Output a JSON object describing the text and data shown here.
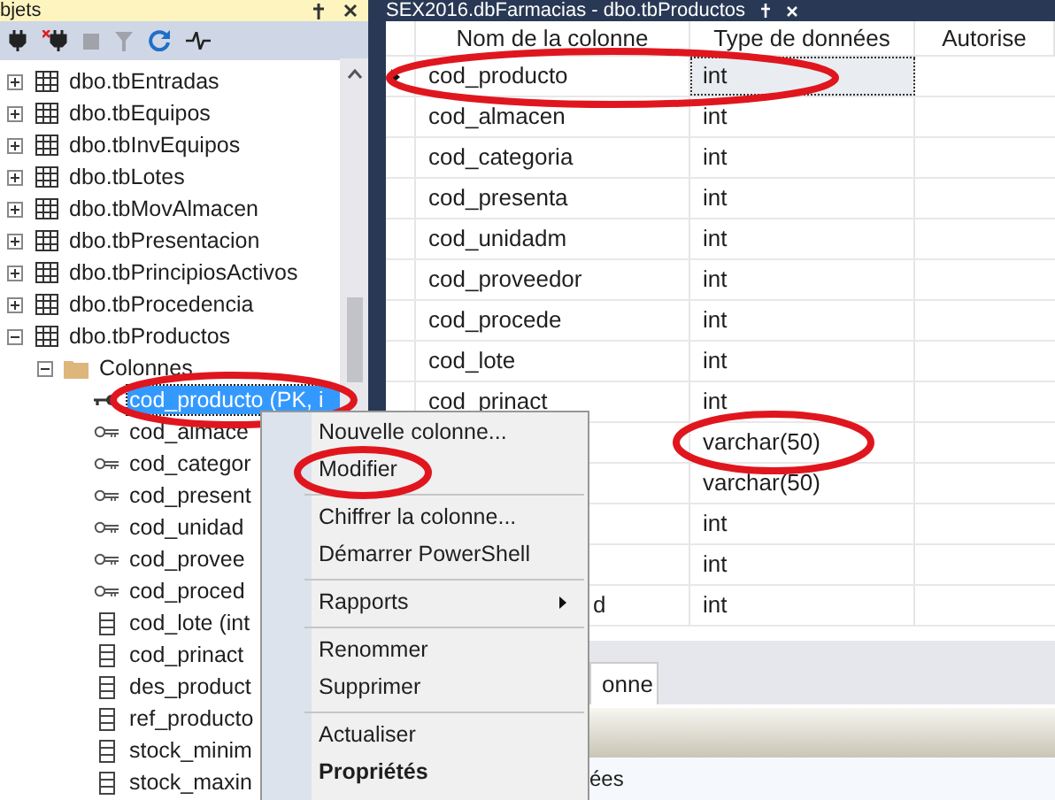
{
  "object_explorer": {
    "title": "bjets",
    "tree": [
      {
        "label": "dbo.tbEntradas",
        "kind": "table",
        "expanded": false
      },
      {
        "label": "dbo.tbEquipos",
        "kind": "table",
        "expanded": false
      },
      {
        "label": "dbo.tbInvEquipos",
        "kind": "table",
        "expanded": false
      },
      {
        "label": "dbo.tbLotes",
        "kind": "table",
        "expanded": false
      },
      {
        "label": "dbo.tbMovAlmacen",
        "kind": "table",
        "expanded": false
      },
      {
        "label": "dbo.tbPresentacion",
        "kind": "table",
        "expanded": false
      },
      {
        "label": "dbo.tbPrincipiosActivos",
        "kind": "table",
        "expanded": false
      },
      {
        "label": "dbo.tbProcedencia",
        "kind": "table",
        "expanded": false
      },
      {
        "label": "dbo.tbProductos",
        "kind": "table",
        "expanded": true,
        "children": [
          {
            "label": "Colonnes",
            "kind": "folder",
            "expanded": true,
            "children": [
              {
                "label": "cod_producto (PK, i",
                "kind": "primary-key",
                "selected": true
              },
              {
                "label": "cod_almace",
                "kind": "foreign-key",
                "selected": false
              },
              {
                "label": "cod_categor",
                "kind": "foreign-key",
                "selected": false
              },
              {
                "label": "cod_present",
                "kind": "foreign-key",
                "selected": false
              },
              {
                "label": "cod_unidad",
                "kind": "foreign-key",
                "selected": false
              },
              {
                "label": "cod_provee",
                "kind": "foreign-key",
                "selected": false
              },
              {
                "label": "cod_proced",
                "kind": "foreign-key",
                "selected": false
              },
              {
                "label": "cod_lote (int",
                "kind": "column",
                "selected": false
              },
              {
                "label": "cod_prinact",
                "kind": "column",
                "selected": false
              },
              {
                "label": "des_product",
                "kind": "column",
                "selected": false
              },
              {
                "label": "ref_producto",
                "kind": "column",
                "selected": false
              },
              {
                "label": "stock_minim",
                "kind": "column",
                "selected": false
              },
              {
                "label": "stock_maxin",
                "kind": "column",
                "selected": false
              }
            ]
          }
        ]
      }
    ]
  },
  "context_menu": [
    {
      "kind": "item",
      "label": "Nouvelle colonne..."
    },
    {
      "kind": "item",
      "label": "Modifier"
    },
    {
      "kind": "separator"
    },
    {
      "kind": "item",
      "label": "Chiffrer la colonne..."
    },
    {
      "kind": "item",
      "label": "Démarrer PowerShell"
    },
    {
      "kind": "separator"
    },
    {
      "kind": "submenu",
      "label": "Rapports"
    },
    {
      "kind": "separator"
    },
    {
      "kind": "item",
      "label": "Renommer"
    },
    {
      "kind": "item",
      "label": "Supprimer"
    },
    {
      "kind": "separator"
    },
    {
      "kind": "item",
      "label": "Actualiser"
    },
    {
      "kind": "default",
      "label": "Propriétés"
    }
  ],
  "designer": {
    "title": "SEX2016.dbFarmacias - dbo.tbProductos",
    "columns": [
      "Nom de la colonne",
      "Type de données",
      "Autorise"
    ],
    "rows": [
      {
        "name": "cod_producto",
        "type": "int",
        "current": true
      },
      {
        "name": "cod_almacen",
        "type": "int",
        "current": false
      },
      {
        "name": "cod_categoria",
        "type": "int",
        "current": false
      },
      {
        "name": "cod_presenta",
        "type": "int",
        "current": false
      },
      {
        "name": "cod_unidadm",
        "type": "int",
        "current": false
      },
      {
        "name": "cod_proveedor",
        "type": "int",
        "current": false
      },
      {
        "name": "cod_procede",
        "type": "int",
        "current": false
      },
      {
        "name": "cod_lote",
        "type": "int",
        "current": false
      },
      {
        "name": "cod_prinact",
        "type": "int",
        "current": false
      },
      {
        "type": "varchar(50)",
        "current": false
      },
      {
        "type": "varchar(50)",
        "current": false
      },
      {
        "type": "int",
        "current": false
      },
      {
        "type": "int",
        "current": false
      },
      {
        "name": "d",
        "name_covered": true,
        "type": "int",
        "current": false
      }
    ],
    "properties_tab": "onne",
    "properties_label": "ées"
  }
}
